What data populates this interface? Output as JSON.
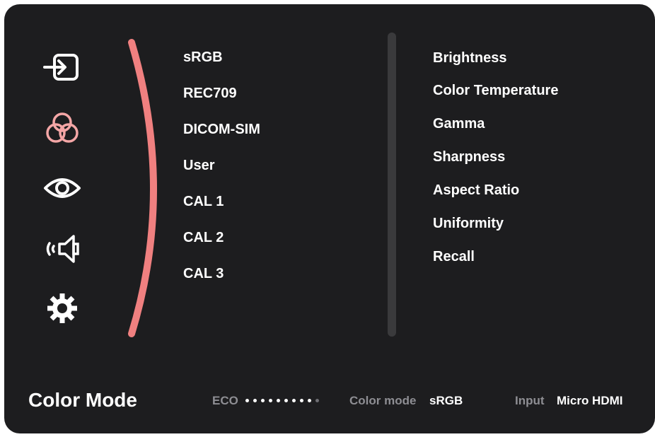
{
  "accent_color": "#f08080",
  "side_icons": [
    {
      "name": "input-icon",
      "active": false
    },
    {
      "name": "color-adjust-icon",
      "active": true
    },
    {
      "name": "view-mode-icon",
      "active": false
    },
    {
      "name": "audio-icon",
      "active": false
    },
    {
      "name": "settings-icon",
      "active": false
    }
  ],
  "color_modes": [
    "sRGB",
    "REC709",
    "DICOM-SIM",
    "User",
    "CAL 1",
    "CAL 2",
    "CAL 3"
  ],
  "submenu": [
    "Brightness",
    "Color Temperature",
    "Gamma",
    "Sharpness",
    "Aspect Ratio",
    "Uniformity",
    "Recall"
  ],
  "footer": {
    "title": "Color Mode",
    "eco_label": "ECO",
    "eco_level": 0.9,
    "color_mode_label": "Color mode",
    "color_mode_value": "sRGB",
    "input_label": "Input",
    "input_value": "Micro HDMI"
  }
}
